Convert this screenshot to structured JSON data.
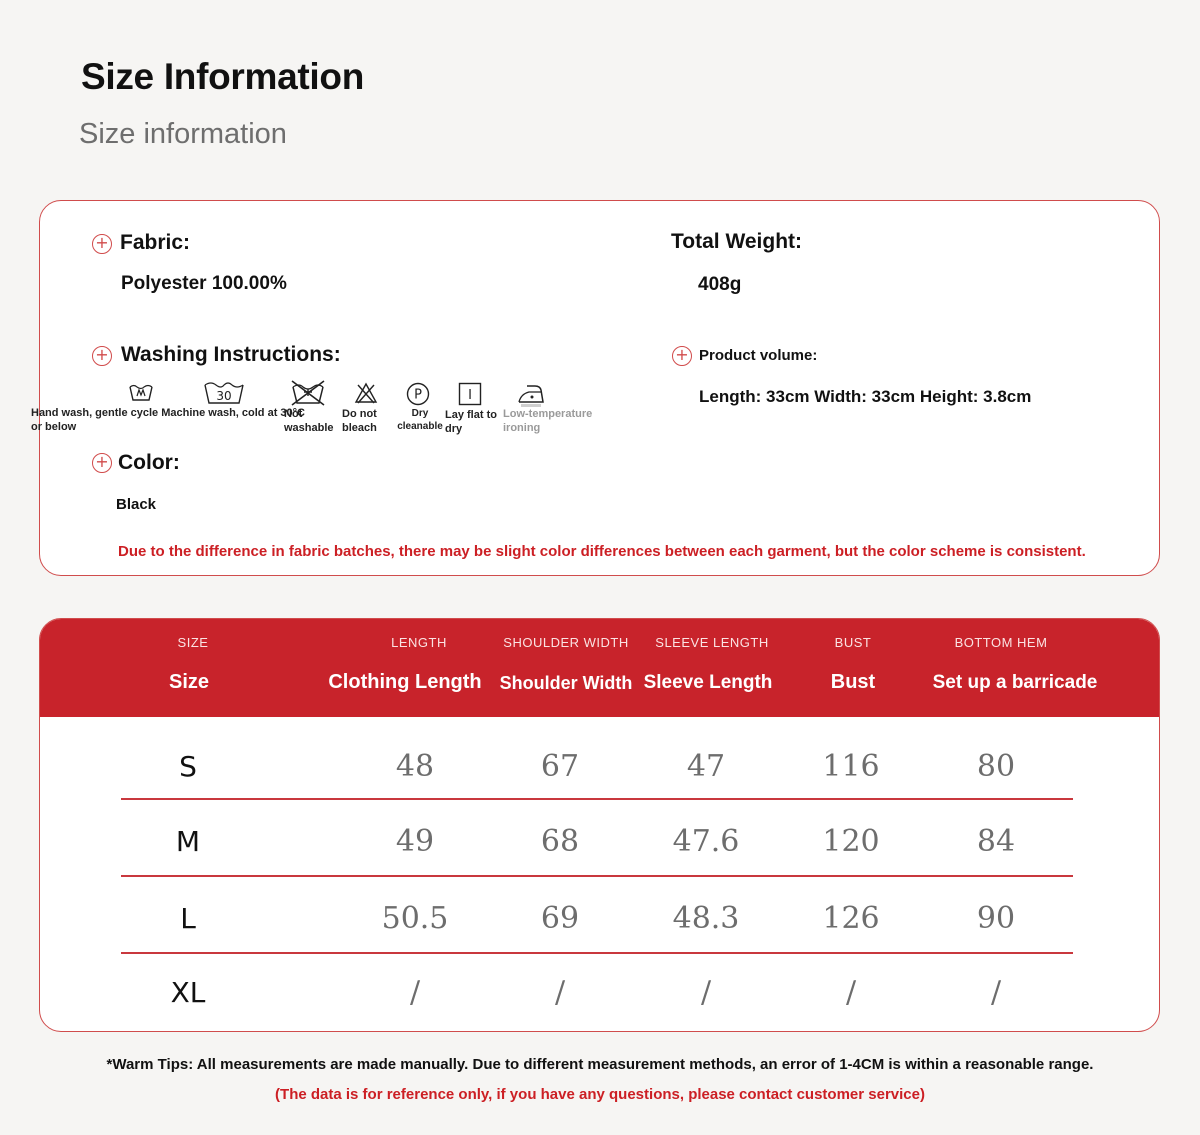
{
  "header": {
    "title": "Size Information",
    "subtitle": "Size information"
  },
  "info": {
    "fabric_label": "Fabric:",
    "fabric_value": "Polyester 100.00%",
    "weight_label": "Total Weight:",
    "weight_value": "408g",
    "washing_label": "Washing Instructions:",
    "volume_label": "Product volume:",
    "volume_value": "Length: 33cm Width: 33cm Height: 3.8cm",
    "color_label": "Color:",
    "color_value": "Black",
    "note": "Due to the difference in fabric batches, there may be slight color differences between each garment, but the color scheme is consistent.",
    "washing": [
      {
        "icon": "hand-wash-icon",
        "text": "Hand wash, gentle cycle Machine wash, cold at 30°C or below"
      },
      {
        "icon": "machine-wash-30-icon",
        "text": "30"
      },
      {
        "icon": "not-washable-icon",
        "text": "Not washable"
      },
      {
        "icon": "do-not-bleach-icon",
        "text": "Do not bleach"
      },
      {
        "icon": "dry-clean-icon",
        "text": "Dry cleanable"
      },
      {
        "icon": "lay-flat-dry-icon",
        "text": "Lay flat to dry"
      },
      {
        "icon": "low-temp-iron-icon",
        "text": "Low-temperature ironing"
      }
    ],
    "wash_symbols": {
      "dry_clean": "P",
      "lay_flat": "I"
    }
  },
  "table": {
    "columns": [
      {
        "en": "SIZE",
        "label": "Size"
      },
      {
        "en": "LENGTH",
        "label": "Clothing Length"
      },
      {
        "en": "SHOULDER WIDTH",
        "label": "Shoulder Width"
      },
      {
        "en": "SLEEVE LENGTH",
        "label": "Sleeve Length"
      },
      {
        "en": "BUST",
        "label": "Bust"
      },
      {
        "en": "BOTTOM HEM",
        "label": "Set up a barricade"
      }
    ],
    "rows": [
      [
        "S",
        "48",
        "67",
        "47",
        "116",
        "80"
      ],
      [
        "M",
        "49",
        "68",
        "47.6",
        "120",
        "84"
      ],
      [
        "L",
        "50.5",
        "69",
        "48.3",
        "126",
        "90"
      ],
      [
        "XL",
        "/",
        "/",
        "/",
        "/",
        "/"
      ]
    ]
  },
  "footer": {
    "tip": "*Warm Tips: All measurements are made manually. Due to different measurement methods, an error of 1-4CM is within a reasonable range.",
    "contact": "(The data is for reference only, if you have any questions, please contact customer service)"
  },
  "colors": {
    "accent": "#c8232b",
    "background": "#f6f5f3",
    "note": "#cc1f24"
  }
}
